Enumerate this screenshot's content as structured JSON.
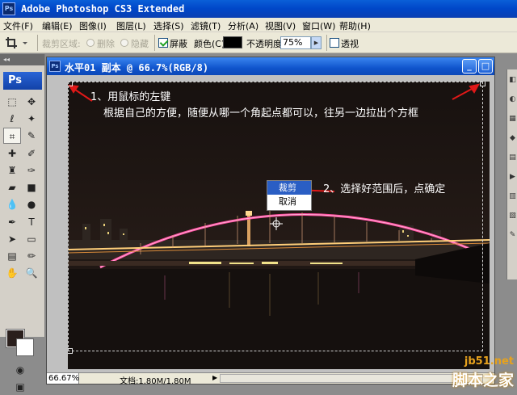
{
  "app": {
    "title": "Adobe Photoshop CS3 Extended",
    "logo": "Ps"
  },
  "menu": [
    "文件(F)",
    "编辑(E)",
    "图像(I)",
    "图层(L)",
    "选择(S)",
    "滤镜(T)",
    "分析(A)",
    "视图(V)",
    "窗口(W)",
    "帮助(H)"
  ],
  "options": {
    "crop_area_label": "裁剪区域:",
    "delete_label": "删除",
    "hide_label": "隐藏",
    "shield_label": "屏蔽",
    "color_label": "颜色(C):",
    "opacity_label": "不透明度:",
    "opacity_value": "75%",
    "perspective_label": "透视",
    "shield_checked": true,
    "shield_color": "#000000"
  },
  "toolbox": {
    "badge": "Ps"
  },
  "document": {
    "title": "水平01 副本 @ 66.7%(RGB/8)",
    "zoom": "66.67%",
    "doc_info": "文档:1.80M/1.80M"
  },
  "annotations": {
    "step1_line1": "1、用鼠标的左键",
    "step1_line2": "根据自己的方便，随便从哪一个角起点都可以，往另一边拉出个方框",
    "step2": "2、选择好范围后，点确定"
  },
  "context_menu": {
    "items": [
      "裁剪",
      "取消"
    ],
    "highlighted": 0
  },
  "watermark": {
    "site": "jb51.net",
    "brand": "脚本之家"
  },
  "colors": {
    "foreground": "#2a1f1c",
    "background": "#ffffff",
    "bridge": "#ff4fa0",
    "title_bar": "#0a4fd0"
  }
}
